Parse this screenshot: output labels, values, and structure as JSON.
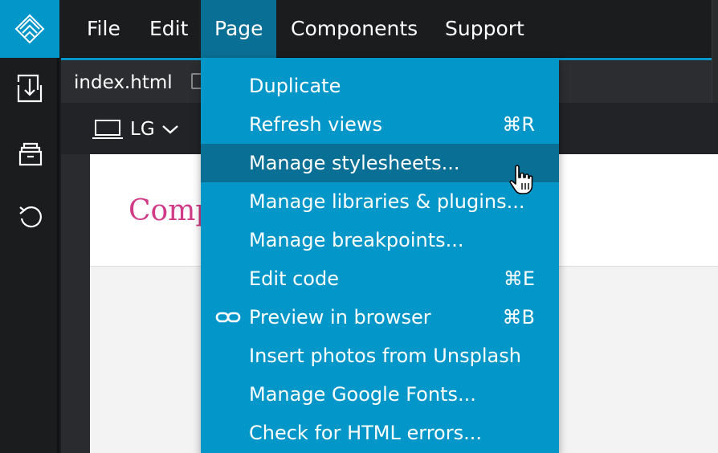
{
  "menubar": {
    "items": [
      {
        "label": "File"
      },
      {
        "label": "Edit"
      },
      {
        "label": "Page"
      },
      {
        "label": "Components"
      },
      {
        "label": "Support"
      }
    ],
    "active_index": 2
  },
  "sidebar": {
    "icons": [
      "import-icon",
      "archive-icon",
      "undo-icon"
    ]
  },
  "tabbar": {
    "active_tab": "index.html"
  },
  "toolbar": {
    "device_label": "LG",
    "device_icon": "laptop-icon"
  },
  "page_preview": {
    "heading": "Comp"
  },
  "dropdown": {
    "items": [
      {
        "label": "Duplicate",
        "shortcut": ""
      },
      {
        "label": "Refresh views",
        "shortcut": "⌘R"
      },
      {
        "label": "Manage stylesheets...",
        "shortcut": ""
      },
      {
        "label": "Manage libraries & plugins...",
        "shortcut": ""
      },
      {
        "label": "Manage breakpoints...",
        "shortcut": ""
      },
      {
        "label": "Edit code",
        "shortcut": "⌘E"
      },
      {
        "label": "Preview in browser",
        "shortcut": "⌘B",
        "icon": "link-icon"
      },
      {
        "label": "Insert photos from Unsplash",
        "shortcut": ""
      },
      {
        "label": "Manage Google Fonts...",
        "shortcut": ""
      },
      {
        "label": "Check for HTML errors...",
        "shortcut": ""
      }
    ],
    "highlighted_index": 2
  },
  "colors": {
    "accent": "#0397c9",
    "highlight": "#0a6f94",
    "menubar_bg": "#1b1c1e",
    "heading_pink": "#d03a86"
  }
}
